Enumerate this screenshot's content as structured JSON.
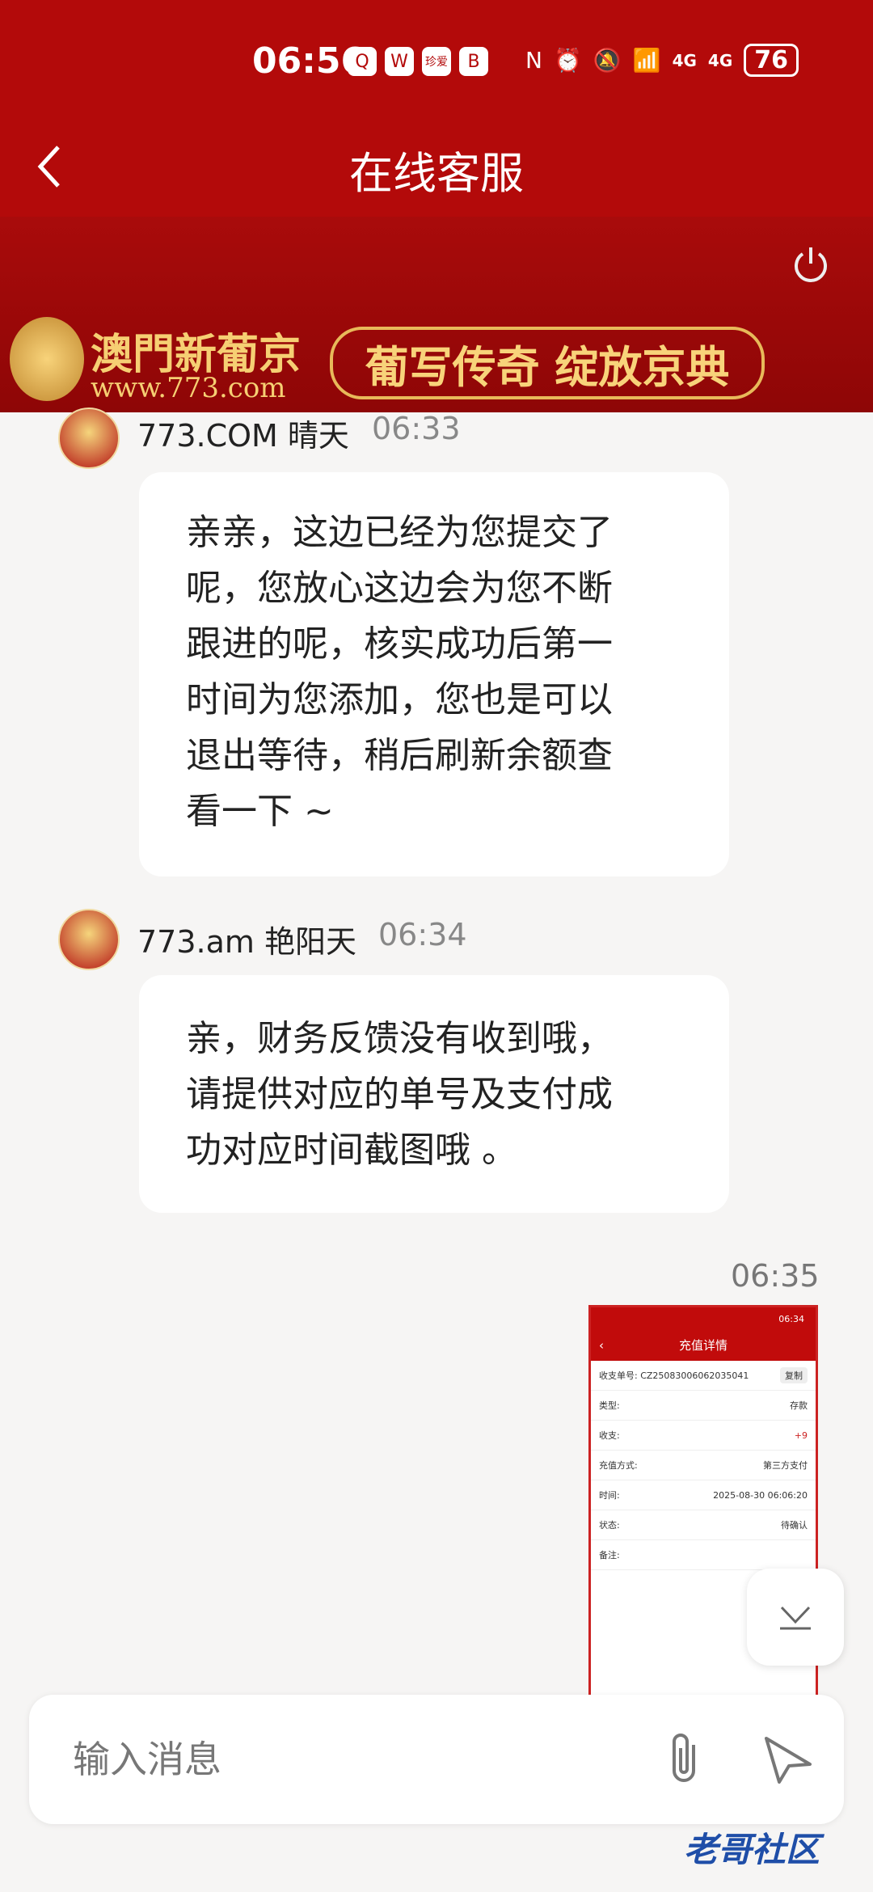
{
  "status_bar": {
    "time": "06:56",
    "icons": [
      "qq",
      "wechat",
      "珍爱",
      "bank"
    ],
    "signal_labels": [
      "6",
      "4G",
      "4G"
    ],
    "battery": "76"
  },
  "header": {
    "title": "在线客服"
  },
  "banner": {
    "brand": "澳門新葡京",
    "url": "www.773.com",
    "slogan": "葡写传奇 绽放京典"
  },
  "messages": [
    {
      "sender": "773.COM 晴天",
      "time": "06:33",
      "text": "亲亲，这边已经为您提交了\n呢，您放心这边会为您不断\n跟进的呢，核实成功后第一\n时间为您添加，您也是可以\n退出等待，稍后刷新余额查\n看一下 ~"
    },
    {
      "sender": "773.am 艳阳天",
      "time": "06:34",
      "text": "亲，财务反馈没有收到哦，\n请提供对应的单号及支付成\n功对应时间截图哦 。"
    }
  ],
  "my_message": {
    "time": "06:35",
    "screenshot": {
      "status_time": "06:34",
      "title": "充值详情",
      "order_label": "收支单号:",
      "order_no": "CZ25083006062035041",
      "copy": "复制",
      "rows": [
        {
          "label": "类型:",
          "value": "存款"
        },
        {
          "label": "收支:",
          "value": "+9"
        },
        {
          "label": "充值方式:",
          "value": "第三方支付"
        },
        {
          "label": "时间:",
          "value": "2025-08-30 06:06:20"
        },
        {
          "label": "状态:",
          "value": "待确认"
        },
        {
          "label": "备注:",
          "value": ""
        }
      ]
    }
  },
  "input": {
    "placeholder": "输入消息"
  },
  "watermark": "老哥社区",
  "colors": {
    "header_red": "#b30a0a",
    "gold": "#f6cf73",
    "bg": "#f6f5f4"
  }
}
